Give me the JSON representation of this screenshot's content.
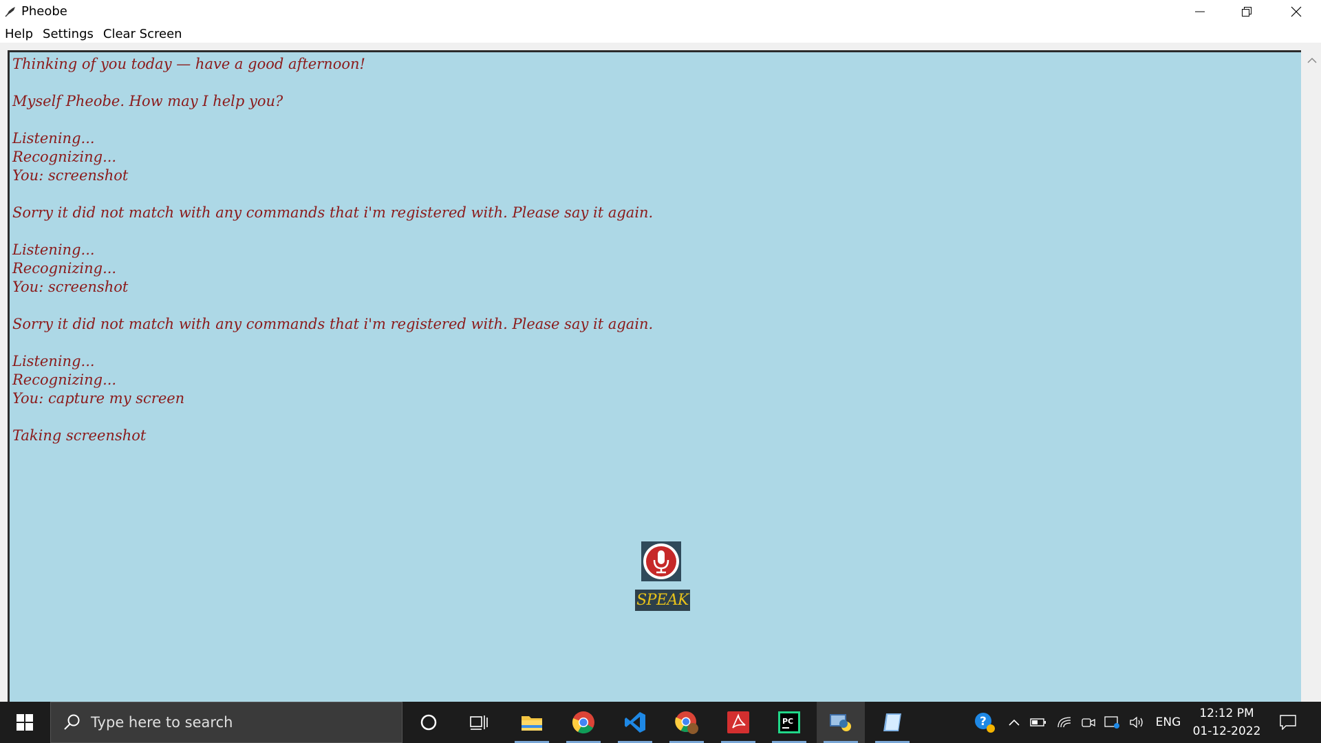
{
  "window": {
    "title": "Pheobe"
  },
  "menu": {
    "items": [
      "Help",
      "Settings",
      "Clear Screen"
    ]
  },
  "chat": {
    "lines": [
      "Thinking of you today — have a good afternoon!",
      "",
      "Myself Pheobe. How may I help you?",
      "",
      "Listening...",
      "Recognizing...",
      "You: screenshot",
      "",
      "Sorry it did not match with any commands that i'm registered with. Please say it again.",
      "",
      "Listening...",
      "Recognizing...",
      "You: screenshot",
      "",
      "Sorry it did not match with any commands that i'm registered with. Please say it again.",
      "",
      "Listening...",
      "Recognizing...",
      "You: capture my screen",
      "",
      "Taking screenshot"
    ],
    "text_color": "#8b1a1a",
    "background": "#add8e6"
  },
  "speak": {
    "label": "SPEAK",
    "mic_icon": "microphone-icon"
  },
  "taskbar": {
    "search_placeholder": "Type here to search",
    "language": "ENG",
    "time": "12:12 PM",
    "date": "01-12-2022",
    "apps": [
      "cortana",
      "task-view",
      "file-explorer",
      "chrome",
      "vscode",
      "chrome-profile",
      "acrobat",
      "pycharm",
      "python",
      "notepad"
    ]
  }
}
